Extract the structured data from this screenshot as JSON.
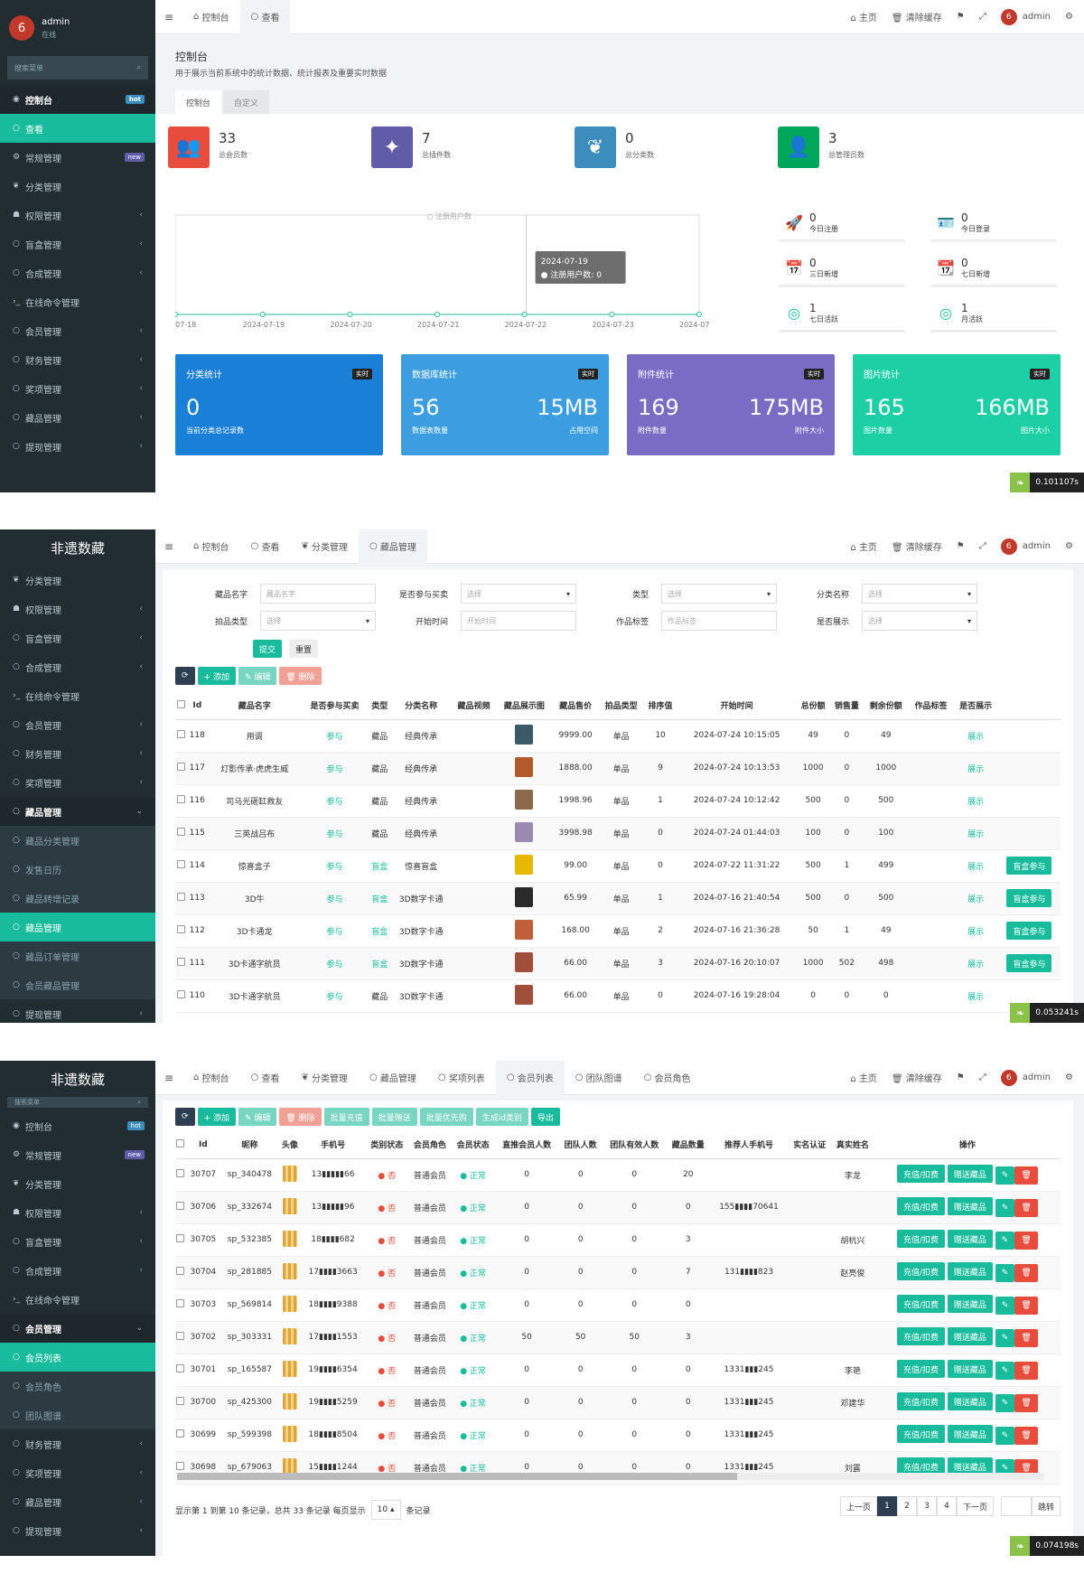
{
  "common": {
    "home": "主页",
    "clear_cache": "清除缓存",
    "admin": "admin",
    "brand": "非遗数藏"
  },
  "s1": {
    "user_name": "admin",
    "user_status": "在线",
    "search_placeholder": "搜索菜单",
    "tabs": [
      "控制台",
      "查看"
    ],
    "sidebar": [
      {
        "label": "控制台",
        "tag": "hot",
        "icon": "dashboard-icon",
        "state": "bold"
      },
      {
        "label": "查看",
        "icon": "circle-icon",
        "state": "active"
      },
      {
        "label": "常规管理",
        "tag": "new",
        "icon": "cogs-icon"
      },
      {
        "label": "分类管理",
        "icon": "leaf-icon"
      },
      {
        "label": "权限管理",
        "arrow": "‹",
        "icon": "group-icon"
      },
      {
        "label": "盲盒管理",
        "arrow": "‹",
        "icon": "circle-icon"
      },
      {
        "label": "合成管理",
        "arrow": "‹",
        "icon": "circle-icon"
      },
      {
        "label": "在线命令管理",
        "icon": "terminal-icon"
      },
      {
        "label": "会员管理",
        "arrow": "‹",
        "icon": "circle-icon"
      },
      {
        "label": "财务管理",
        "arrow": "‹",
        "icon": "circle-icon"
      },
      {
        "label": "奖项管理",
        "arrow": "‹",
        "icon": "circle-icon"
      },
      {
        "label": "藏品管理",
        "arrow": "‹",
        "icon": "circle-icon"
      },
      {
        "label": "提现管理",
        "arrow": "‹",
        "icon": "circle-icon"
      }
    ],
    "page_title": "控制台",
    "page_desc": "用于展示当前系统中的统计数据、统计报表及重要实时数据",
    "sub_tabs": [
      "控制台",
      "自定义"
    ],
    "kpis": [
      {
        "value": "33",
        "label": "总会员数",
        "color": "#e74c3c",
        "icon": "users-icon"
      },
      {
        "value": "7",
        "label": "总插件数",
        "color": "#605ca8",
        "icon": "magic-icon"
      },
      {
        "value": "0",
        "label": "总分类数",
        "color": "#3c8dbc",
        "icon": "leaf-icon"
      },
      {
        "value": "3",
        "label": "总管理员数",
        "color": "#00a65a",
        "icon": "user-icon"
      }
    ],
    "chart_data": {
      "type": "line",
      "series": [
        {
          "name": "注册用户数",
          "values": [
            0,
            0,
            0,
            0,
            0,
            0,
            0
          ]
        }
      ],
      "categories": [
        "07-18",
        "2024-07-19",
        "2024-07-20",
        "2024-07-21",
        "2024-07-22",
        "2024-07-23",
        "2024-07"
      ],
      "tooltip_date": "2024-07-19",
      "tooltip_label": "注册用户数: 0"
    },
    "mini_stats": [
      {
        "value": "0",
        "label": "今日注册",
        "icon": "rocket-icon"
      },
      {
        "value": "0",
        "label": "今日登录",
        "icon": "id-card-icon"
      },
      {
        "value": "0",
        "label": "三日新增",
        "icon": "calendar-icon"
      },
      {
        "value": "0",
        "label": "七日新增",
        "icon": "calendar-plus-icon"
      },
      {
        "value": "1",
        "label": "七日活跃",
        "icon": "user-circle-icon"
      },
      {
        "value": "1",
        "label": "月活跃",
        "icon": "user-circle-icon"
      }
    ],
    "cards": [
      {
        "title": "分类统计",
        "live": "实时",
        "v1": "0",
        "v2": "",
        "l1": "当前分类总记录数",
        "l2": "",
        "color": "#1a7fd6"
      },
      {
        "title": "数据库统计",
        "live": "实时",
        "v1": "56",
        "v2": "15MB",
        "l1": "数据表数量",
        "l2": "占用空间",
        "color": "#3c9ee0"
      },
      {
        "title": "附件统计",
        "live": "实时",
        "v1": "169",
        "v2": "175MB",
        "l1": "附件数量",
        "l2": "附件大小",
        "color": "#7a6bc5"
      },
      {
        "title": "图片统计",
        "live": "实时",
        "v1": "165",
        "v2": "166MB",
        "l1": "图片数量",
        "l2": "图片大小",
        "color": "#1ccfa5"
      }
    ],
    "timer": "0.101107s"
  },
  "s2": {
    "tabs": [
      "控制台",
      "查看",
      "分类管理",
      "藏品管理"
    ],
    "sidebar": [
      {
        "label": "分类管理",
        "icon": "leaf-icon"
      },
      {
        "label": "权限管理",
        "arrow": "‹",
        "icon": "group-icon"
      },
      {
        "label": "盲盒管理",
        "arrow": "‹",
        "icon": "circle-icon"
      },
      {
        "label": "合成管理",
        "arrow": "‹",
        "icon": "circle-icon"
      },
      {
        "label": "在线命令管理",
        "icon": "terminal-icon"
      },
      {
        "label": "会员管理",
        "arrow": "‹",
        "icon": "circle-icon"
      },
      {
        "label": "财务管理",
        "arrow": "‹",
        "icon": "circle-icon"
      },
      {
        "label": "奖项管理",
        "arrow": "‹",
        "icon": "circle-icon"
      },
      {
        "label": "藏品管理",
        "arrow": "⌄",
        "icon": "circle-icon",
        "state": "bold"
      },
      {
        "label": "藏品分类管理",
        "icon": "circle-icon",
        "state": "sub"
      },
      {
        "label": "发售日历",
        "icon": "circle-icon",
        "state": "sub"
      },
      {
        "label": "藏品转增记录",
        "icon": "circle-icon",
        "state": "sub"
      },
      {
        "label": "藏品管理",
        "icon": "circle-icon",
        "state": "active"
      },
      {
        "label": "藏品订单管理",
        "icon": "circle-icon",
        "state": "sub"
      },
      {
        "label": "会员藏品管理",
        "icon": "circle-icon",
        "state": "sub"
      },
      {
        "label": "提现管理",
        "arrow": "‹",
        "icon": "circle-icon"
      }
    ],
    "filters_row1": [
      {
        "label": "藏品名字",
        "ph": "藏品名字",
        "sel": false
      },
      {
        "label": "是否参与买卖",
        "ph": "选择",
        "sel": true
      },
      {
        "label": "类型",
        "ph": "选择",
        "sel": true
      },
      {
        "label": "分类名称",
        "ph": "选择",
        "sel": true
      }
    ],
    "filters_row2": [
      {
        "label": "拍品类型",
        "ph": "选择",
        "sel": true
      },
      {
        "label": "开始时间",
        "ph": "开始时间",
        "sel": false
      },
      {
        "label": "作品标签",
        "ph": "作品标签",
        "sel": false
      },
      {
        "label": "是否展示",
        "ph": "选择",
        "sel": true
      }
    ],
    "submit": "提交",
    "reset": "重置",
    "toolbar": [
      "⟳",
      "+ 添加",
      "✎ 编辑",
      "🗑 删除"
    ],
    "headers": [
      "Id",
      "藏品名字",
      "是否参与买卖",
      "类型",
      "分类名称",
      "藏品视频",
      "藏品展示图",
      "藏品售价",
      "拍品类型",
      "排序值",
      "开始时间",
      "总份额",
      "销售量",
      "剩余份额",
      "作品标签",
      "是否展示"
    ],
    "rows": [
      [
        "118",
        "用调",
        "参与",
        "藏品",
        "经典传承",
        "",
        "#3a5a6a",
        "9999.00",
        "单品",
        "10",
        "2024-07-24 10:15:05",
        "49",
        "0",
        "49",
        "",
        "展示",
        ""
      ],
      [
        "117",
        "灯影传承·虎虎生威",
        "参与",
        "藏品",
        "经典传承",
        "",
        "#b35a2a",
        "1888.00",
        "单品",
        "9",
        "2024-07-24 10:13:53",
        "1000",
        "0",
        "1000",
        "",
        "展示",
        ""
      ],
      [
        "116",
        "司马光砸缸救友",
        "参与",
        "藏品",
        "经典传承",
        "",
        "#8a6a4a",
        "1998.96",
        "单品",
        "1",
        "2024-07-24 10:12:42",
        "500",
        "0",
        "500",
        "",
        "展示",
        ""
      ],
      [
        "115",
        "三英战吕布",
        "参与",
        "藏品",
        "经典传承",
        "",
        "#9a8ab0",
        "3998.98",
        "单品",
        "0",
        "2024-07-24 01:44:03",
        "100",
        "0",
        "100",
        "",
        "展示",
        ""
      ],
      [
        "114",
        "惊喜盒子",
        "参与",
        "盲盒",
        "惊喜盲盒",
        "",
        "#e6b800",
        "99.00",
        "单品",
        "0",
        "2024-07-22 11:31:22",
        "500",
        "1",
        "499",
        "",
        "展示",
        "盲盒参与"
      ],
      [
        "113",
        "3D牛",
        "参与",
        "盲盒",
        "3D数字卡通",
        "",
        "#2a2a2a",
        "65.99",
        "单品",
        "1",
        "2024-07-16 21:40:54",
        "500",
        "0",
        "500",
        "",
        "展示",
        "盲盒参与"
      ],
      [
        "112",
        "3D卡通龙",
        "参与",
        "盲盒",
        "3D数字卡通",
        "",
        "#c0603a",
        "168.00",
        "单品",
        "2",
        "2024-07-16 21:36:28",
        "50",
        "1",
        "49",
        "",
        "展示",
        "盲盒参与"
      ],
      [
        "111",
        "3D卡通字航员",
        "参与",
        "盲盒",
        "3D数字卡通",
        "",
        "#a0503a",
        "66.00",
        "单品",
        "3",
        "2024-07-16 20:10:07",
        "1000",
        "502",
        "498",
        "",
        "展示",
        "盲盒参与"
      ],
      [
        "110",
        "3D卡通字航员",
        "参与",
        "藏品",
        "3D数字卡通",
        "",
        "#a0503a",
        "66.00",
        "单品",
        "0",
        "2024-07-16 19:28:04",
        "0",
        "0",
        "0",
        "",
        "展示",
        ""
      ]
    ],
    "timer": "0.053241s"
  },
  "s3": {
    "tabs": [
      "控制台",
      "查看",
      "分类管理",
      "藏品管理",
      "奖项列表",
      "会员列表",
      "团队图谱",
      "会员角色"
    ],
    "search_placeholder": "搜索菜单",
    "sidebar": [
      {
        "label": "控制台",
        "tag": "hot",
        "icon": "dashboard-icon"
      },
      {
        "label": "常规管理",
        "tag": "new",
        "icon": "cogs-icon"
      },
      {
        "label": "分类管理",
        "icon": "leaf-icon"
      },
      {
        "label": "权限管理",
        "arrow": "‹",
        "icon": "group-icon"
      },
      {
        "label": "盲盒管理",
        "arrow": "‹",
        "icon": "circle-icon"
      },
      {
        "label": "合成管理",
        "arrow": "‹",
        "icon": "circle-icon"
      },
      {
        "label": "在线命令管理",
        "icon": "terminal-icon"
      },
      {
        "label": "会员管理",
        "arrow": "⌄",
        "icon": "circle-icon",
        "state": "bold"
      },
      {
        "label": "会员列表",
        "icon": "circle-icon",
        "state": "active"
      },
      {
        "label": "会员角色",
        "icon": "circle-icon",
        "state": "sub"
      },
      {
        "label": "团队图谱",
        "icon": "circle-icon",
        "state": "sub"
      },
      {
        "label": "财务管理",
        "arrow": "‹",
        "icon": "circle-icon"
      },
      {
        "label": "奖项管理",
        "arrow": "‹",
        "icon": "circle-icon"
      },
      {
        "label": "藏品管理",
        "arrow": "‹",
        "icon": "circle-icon"
      },
      {
        "label": "提现管理",
        "arrow": "‹",
        "icon": "circle-icon"
      }
    ],
    "toolbar": [
      "⟳",
      "+ 添加",
      "✎ 编辑",
      "🗑 删除",
      "批量充值",
      "批量赠送",
      "批量优先购",
      "生成id类别",
      "导出"
    ],
    "headers": [
      "Id",
      "昵称",
      "头像",
      "手机号",
      "类别状态",
      "会员角色",
      "会员状态",
      "直推会员人数",
      "团队人数",
      "团队有效人数",
      "藏品数量",
      "推荐人手机号",
      "实名认证",
      "真实姓名",
      "操作"
    ],
    "rows": [
      [
        "30707",
        "sp_340478",
        "13▮▮▮▮▮66",
        "否",
        "普通会员",
        "正常",
        "0",
        "0",
        "0",
        "20",
        "",
        "李龙"
      ],
      [
        "30706",
        "sp_332674",
        "13▮▮▮▮▮96",
        "否",
        "普通会员",
        "正常",
        "0",
        "0",
        "0",
        "0",
        "155▮▮▮▮70641",
        ""
      ],
      [
        "30705",
        "sp_532385",
        "18▮▮▮▮682",
        "否",
        "普通会员",
        "正常",
        "0",
        "0",
        "0",
        "3",
        "",
        "胡杭兴"
      ],
      [
        "30704",
        "sp_281885",
        "17▮▮▮▮3663",
        "否",
        "普通会员",
        "正常",
        "0",
        "0",
        "0",
        "7",
        "131▮▮▮▮823",
        "赵亮俊"
      ],
      [
        "30703",
        "sp_569814",
        "18▮▮▮▮9388",
        "否",
        "普通会员",
        "正常",
        "0",
        "0",
        "0",
        "0",
        "",
        ""
      ],
      [
        "30702",
        "sp_303331",
        "17▮▮▮▮1553",
        "否",
        "普通会员",
        "正常",
        "50",
        "50",
        "50",
        "3",
        "",
        ""
      ],
      [
        "30701",
        "sp_165587",
        "19▮▮▮▮6354",
        "否",
        "普通会员",
        "正常",
        "0",
        "0",
        "0",
        "0",
        "1331▮▮▮245",
        "李艳"
      ],
      [
        "30700",
        "sp_425300",
        "19▮▮▮▮5259",
        "否",
        "普通会员",
        "正常",
        "0",
        "0",
        "0",
        "0",
        "1331▮▮▮245",
        "邓建华"
      ],
      [
        "30699",
        "sp_599398",
        "18▮▮▮▮8504",
        "否",
        "普通会员",
        "正常",
        "0",
        "0",
        "0",
        "0",
        "1331▮▮▮245",
        ""
      ],
      [
        "30698",
        "sp_679063",
        "15▮▮▮▮1244",
        "否",
        "普通会员",
        "正常",
        "0",
        "0",
        "0",
        "0",
        "1331▮▮▮245",
        "刘露"
      ]
    ],
    "op_recharge": "充值/扣费",
    "op_gift": "赠送藏品",
    "pager_info": "显示第 1 到第 10 条记录，总共 33 条记录 每页显示",
    "pager_size": "10",
    "pager_unit": "条记录",
    "pager": [
      "上一页",
      "1",
      "2",
      "3",
      "4",
      "下一页"
    ],
    "jump": "跳转",
    "timer": "0.074198s"
  }
}
